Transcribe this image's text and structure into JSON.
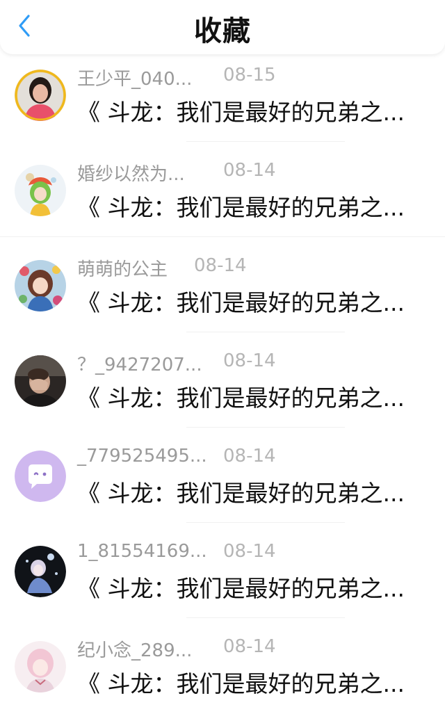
{
  "header": {
    "title": "收藏",
    "back_icon": "chevron-left-icon",
    "accent_color": "#2f9cf6"
  },
  "items": [
    {
      "username": "王少平_040...",
      "date": "08-15",
      "content": "《 斗龙：我们是最好的兄弟之...",
      "avatar": "woman-photo"
    },
    {
      "username": "婚纱以然为...",
      "date": "08-14",
      "content": "《 斗龙：我们是最好的兄弟之...",
      "avatar": "anime-girl-green-hair"
    },
    {
      "username": "萌萌的公主",
      "date": "08-14",
      "content": "《 斗龙：我们是最好的兄弟之...",
      "avatar": "anime-girl-colorful"
    },
    {
      "username": "？_9427207...",
      "date": "08-14",
      "content": "《 斗龙：我们是最好的兄弟之...",
      "avatar": "man-photo-dark"
    },
    {
      "username": "_779525495...",
      "date": "08-14",
      "content": "《 斗龙：我们是最好的兄弟之...",
      "avatar": "default-chat-bubble"
    },
    {
      "username": "1_81554169...",
      "date": "08-14",
      "content": "《 斗龙：我们是最好的兄弟之...",
      "avatar": "anime-fairy-dark"
    },
    {
      "username": "纪小念_289...",
      "date": "08-14",
      "content": "《 斗龙：我们是最好的兄弟之...",
      "avatar": "anime-girl-pink"
    }
  ]
}
